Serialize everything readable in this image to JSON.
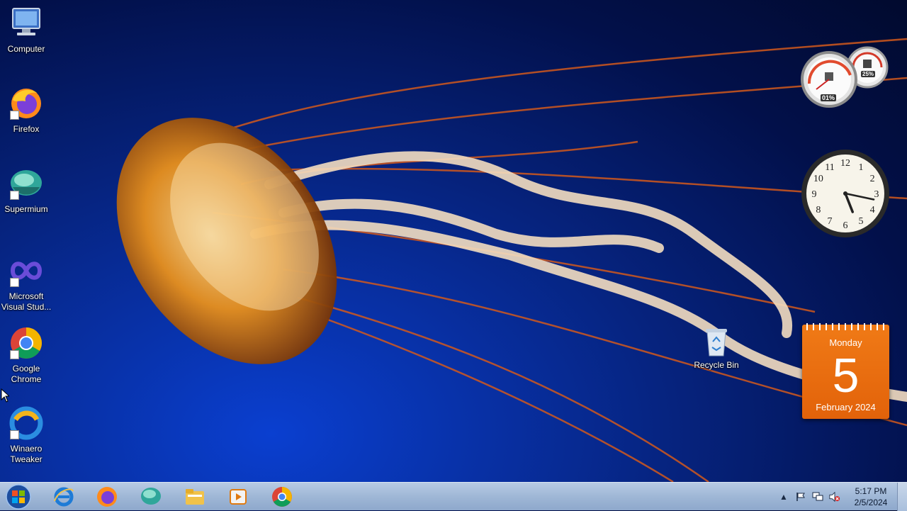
{
  "desktop_icons": [
    {
      "id": "computer",
      "label": "Computer",
      "icon": "computer-icon"
    },
    {
      "id": "firefox",
      "label": "Firefox",
      "icon": "firefox-icon"
    },
    {
      "id": "supermium",
      "label": "Supermium",
      "icon": "supermium-icon"
    },
    {
      "id": "vs",
      "label": "Microsoft\nVisual Stud...",
      "icon": "visual-studio-icon"
    },
    {
      "id": "chrome",
      "label": "Google\nChrome",
      "icon": "chrome-icon"
    },
    {
      "id": "winaero",
      "label": "Winaero\nTweaker",
      "icon": "winaero-tweaker-icon"
    },
    {
      "id": "recycle",
      "label": "Recycle Bin",
      "icon": "recycle-bin-icon"
    }
  ],
  "gadgets": {
    "cpu_meter": {
      "cpu": "01%",
      "memory": "25%"
    },
    "clock": {
      "hour": 5,
      "minute": 17,
      "numerals": [
        "12",
        "1",
        "2",
        "3",
        "4",
        "5",
        "6",
        "7",
        "8",
        "9",
        "10",
        "11"
      ]
    },
    "calendar": {
      "weekday": "Monday",
      "day": "5",
      "month_year": "February 2024"
    }
  },
  "taskbar": {
    "pinned": [
      "internet-explorer-icon",
      "firefox-icon",
      "supermium-icon",
      "file-explorer-icon",
      "media-player-icon",
      "chrome-icon"
    ],
    "clock_time": "5:17 PM",
    "clock_date": "2/5/2024"
  },
  "colors": {
    "calendar_orange": "#e8680e",
    "taskbar": "#a8bedd"
  }
}
